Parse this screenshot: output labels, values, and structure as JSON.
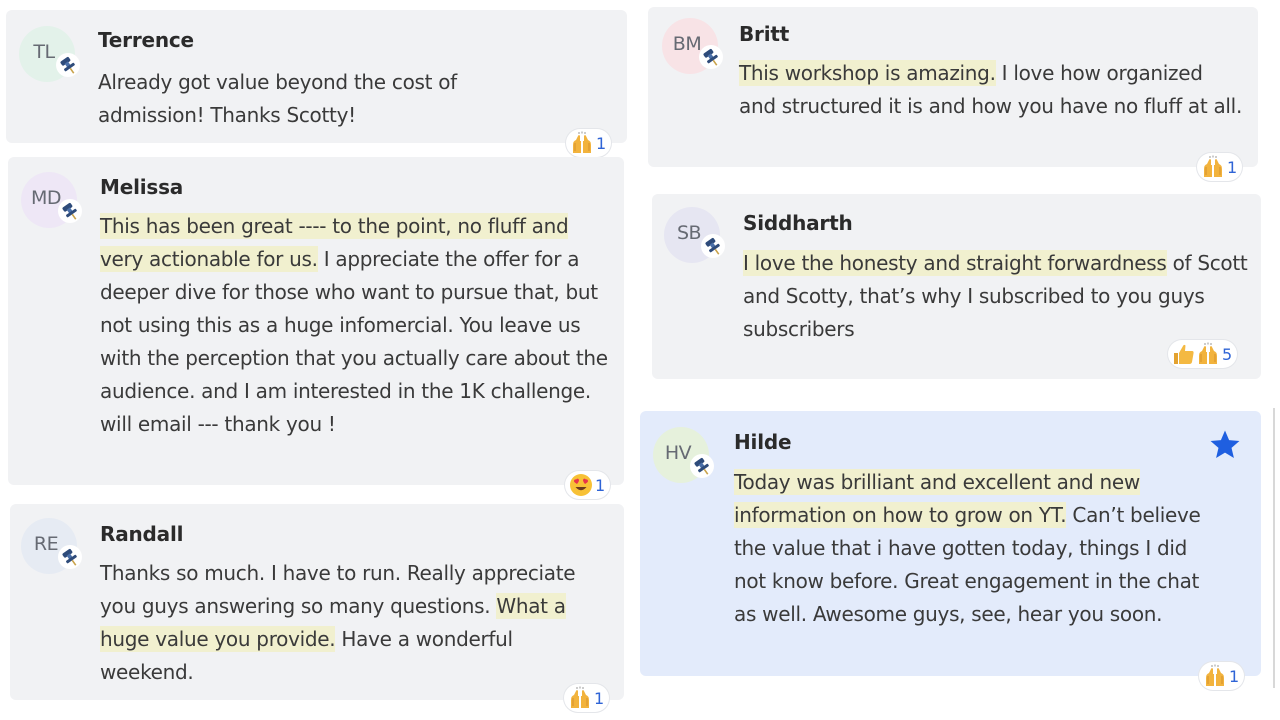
{
  "colors": {
    "card_bg": "#f1f2f4",
    "starred_bg": "#e3ebfb",
    "highlight": "#f1f0cf",
    "reaction_count": "#2f64d6",
    "star": "#1f5fe0"
  },
  "messages": [
    {
      "initials": "TL",
      "name": "Terrence",
      "text_before": "",
      "highlight": "",
      "text_after": "Already got value beyond the cost of admission! Thanks Scotty!",
      "reactions": [
        {
          "icon": "raising-hands-icon"
        }
      ],
      "reaction_count": "1"
    },
    {
      "initials": "MD",
      "name": "Melissa",
      "text_before": "",
      "highlight": "This has been great ---- to the point, no fluff and very actionable for us.",
      "text_after": " I appreciate the offer for a deeper dive for those who want to pursue that, but not using this as a huge infomercial. You leave us with the perception that you actually care about the audience. and I am interested in the 1K challenge. will email --- thank you !",
      "reactions": [
        {
          "icon": "heart-eyes-icon"
        }
      ],
      "reaction_count": "1"
    },
    {
      "initials": "RE",
      "name": "Randall",
      "text_before": "Thanks so much. I have to run. Really appreciate you guys answering so many questions. ",
      "highlight": "What a huge value you provide.",
      "text_after": " Have a wonderful weekend.",
      "reactions": [
        {
          "icon": "raising-hands-icon"
        }
      ],
      "reaction_count": "1"
    },
    {
      "initials": "BM",
      "name": "Britt",
      "text_before": "",
      "highlight": "This workshop is amazing.",
      "text_after": " I love how organized and structured it is and how you have no fluff at all.",
      "reactions": [
        {
          "icon": "raising-hands-icon"
        }
      ],
      "reaction_count": "1"
    },
    {
      "initials": "SB",
      "name": "Siddharth",
      "text_before": "",
      "highlight": "I love the honesty and straight forwardness",
      "text_after": " of Scott and Scotty, that’s why I subscribed to you guys",
      "extra_line": "subscribers",
      "reactions": [
        {
          "icon": "thumbs-up-icon"
        },
        {
          "icon": "raising-hands-icon"
        }
      ],
      "reaction_count": "5"
    },
    {
      "initials": "HV",
      "name": "Hilde",
      "text_before": "",
      "highlight": "Today was brilliant and excellent and new information on how to grow on YT.",
      "text_after": " Can’t believe the value that i have gotten today, things I did not know before. Great engagement in the chat as well. Awesome guys, see, hear you soon.",
      "reactions": [
        {
          "icon": "raising-hands-icon"
        }
      ],
      "reaction_count": "1",
      "starred": true
    }
  ]
}
